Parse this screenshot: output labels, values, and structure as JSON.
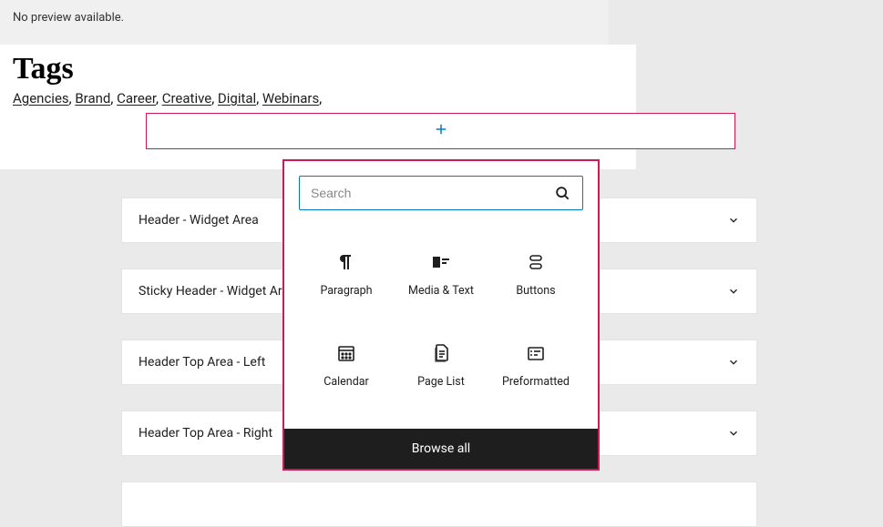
{
  "preview_text": "No preview available.",
  "tags_heading": "Tags",
  "tags": [
    "Agencies",
    "Brand",
    "Career",
    "Creative",
    "Digital",
    "Webinars"
  ],
  "widget_areas": [
    "Header - Widget Area",
    "Sticky Header - Widget Area",
    "Header Top Area - Left",
    "Header Top Area - Right"
  ],
  "inserter": {
    "search_placeholder": "Search",
    "blocks": [
      {
        "label": "Paragraph"
      },
      {
        "label": "Media & Text"
      },
      {
        "label": "Buttons"
      },
      {
        "label": "Calendar"
      },
      {
        "label": "Page List"
      },
      {
        "label": "Preformatted"
      }
    ],
    "browse_all": "Browse all"
  }
}
